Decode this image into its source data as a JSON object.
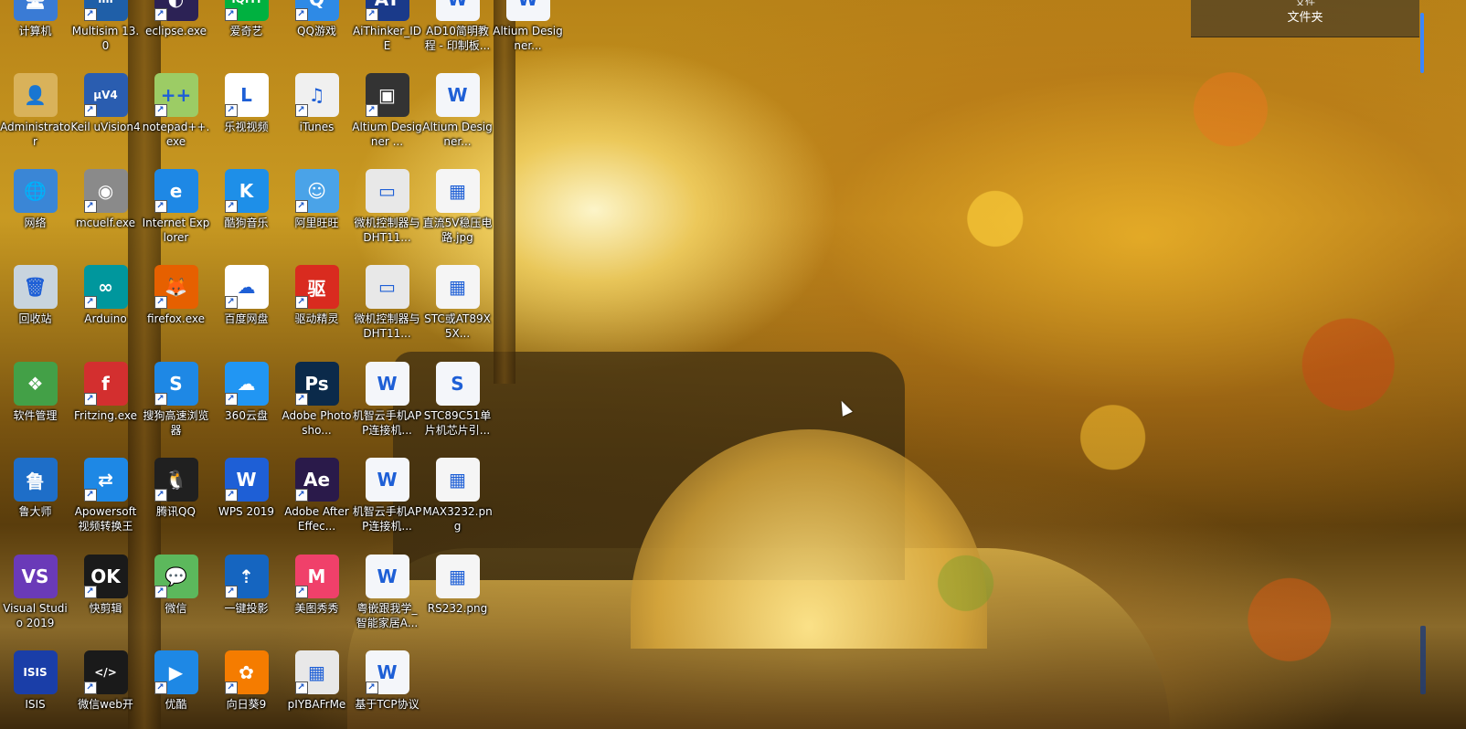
{
  "folder_toolbar": {
    "top_label": "文件",
    "main_label": "文件夹"
  },
  "icons": [
    {
      "label": "计算机",
      "icon": "computer-icon",
      "color": "#3a7bd5",
      "glyph": "🖥",
      "shortcut": false
    },
    {
      "label": "Multisim 13.0",
      "icon": "multisim-icon",
      "color": "#1f5fa8",
      "glyph": "ılıl",
      "shortcut": true
    },
    {
      "label": "eclipse.exe",
      "icon": "eclipse-icon",
      "color": "#2c2255",
      "glyph": "◐",
      "shortcut": true
    },
    {
      "label": "爱奇艺",
      "icon": "iqiyi-icon",
      "color": "#00b140",
      "glyph": "iQIYI",
      "shortcut": true
    },
    {
      "label": "QQ游戏",
      "icon": "qqgame-icon",
      "color": "#2e8ae6",
      "glyph": "Q",
      "shortcut": true
    },
    {
      "label": "AiThinker_IDE",
      "icon": "aithinker-icon",
      "color": "#1a3a8a",
      "glyph": "AT",
      "shortcut": true
    },
    {
      "label": "AD10简明教程 - 印制板...",
      "icon": "word-doc-icon",
      "color": "#f4f6fa",
      "glyph": "W",
      "shortcut": false
    },
    {
      "label": "Altium Designer...",
      "icon": "word-doc-icon",
      "color": "#f4f6fa",
      "glyph": "W",
      "shortcut": false
    },
    {
      "label": "Administrator",
      "icon": "user-folder-icon",
      "color": "#d9b25a",
      "glyph": "👤",
      "shortcut": false
    },
    {
      "label": "Keil uVision4",
      "icon": "keil-icon",
      "color": "#2a5db0",
      "glyph": "μV4",
      "shortcut": true
    },
    {
      "label": "notepad++.exe",
      "icon": "notepad-plus-icon",
      "color": "#9ccc65",
      "glyph": "++",
      "shortcut": true
    },
    {
      "label": "乐视视频",
      "icon": "letv-icon",
      "color": "#ffffff",
      "glyph": "L",
      "shortcut": true
    },
    {
      "label": "iTunes",
      "icon": "itunes-icon",
      "color": "#f0f0f0",
      "glyph": "♫",
      "shortcut": true
    },
    {
      "label": "Altium Designer ...",
      "icon": "altium-icon",
      "color": "#333333",
      "glyph": "▣",
      "shortcut": true
    },
    {
      "label": "Altium Designer...",
      "icon": "word-doc-icon",
      "color": "#f4f6fa",
      "glyph": "W",
      "shortcut": false
    },
    {
      "label": "网络",
      "icon": "network-icon",
      "color": "#3a86d6",
      "glyph": "🌐",
      "shortcut": false
    },
    {
      "label": "mcuelf.exe",
      "icon": "mcuelf-icon",
      "color": "#8a8a8a",
      "glyph": "◉",
      "shortcut": true
    },
    {
      "label": "Internet Explorer",
      "icon": "internet-explorer-icon",
      "color": "#1e88e5",
      "glyph": "e",
      "shortcut": true
    },
    {
      "label": "酷狗音乐",
      "icon": "kugou-icon",
      "color": "#1e8fe8",
      "glyph": "K",
      "shortcut": true
    },
    {
      "label": "阿里旺旺",
      "icon": "aliwangwang-icon",
      "color": "#4aa3e8",
      "glyph": "☺",
      "shortcut": true
    },
    {
      "label": "微机控制器与DHT11...",
      "icon": "image-file-icon",
      "color": "#e8e8e8",
      "glyph": "▭",
      "shortcut": false
    },
    {
      "label": "直流5V稳压电路.jpg",
      "icon": "image-file-icon",
      "color": "#f5f5f5",
      "glyph": "▦",
      "shortcut": false
    },
    {
      "label": "回收站",
      "icon": "recycle-bin-icon",
      "color": "#c8d4de",
      "glyph": "🗑",
      "shortcut": false
    },
    {
      "label": "Arduino",
      "icon": "arduino-icon",
      "color": "#00979d",
      "glyph": "∞",
      "shortcut": true
    },
    {
      "label": "firefox.exe",
      "icon": "firefox-icon",
      "color": "#e66000",
      "glyph": "🦊",
      "shortcut": true
    },
    {
      "label": "百度网盘",
      "icon": "baidu-netdisk-icon",
      "color": "#ffffff",
      "glyph": "☁",
      "shortcut": true
    },
    {
      "label": "驱动精灵",
      "icon": "driver-genius-icon",
      "color": "#d92b1f",
      "glyph": "驱",
      "shortcut": true
    },
    {
      "label": "微机控制器与DHT11...",
      "icon": "image-file-icon",
      "color": "#e8e8e8",
      "glyph": "▭",
      "shortcut": false
    },
    {
      "label": "STC或AT89X5X...",
      "icon": "image-file-icon",
      "color": "#f5f5f5",
      "glyph": "▦",
      "shortcut": false
    },
    {
      "label": "软件管理",
      "icon": "software-manager-icon",
      "color": "#43a047",
      "glyph": "❖",
      "shortcut": false
    },
    {
      "label": "Fritzing.exe",
      "icon": "fritzing-icon",
      "color": "#d32f2f",
      "glyph": "f",
      "shortcut": true
    },
    {
      "label": "搜狗高速浏览器",
      "icon": "sogou-browser-icon",
      "color": "#1e88e5",
      "glyph": "S",
      "shortcut": true
    },
    {
      "label": "360云盘",
      "icon": "360-cloud-icon",
      "color": "#2196f3",
      "glyph": "☁",
      "shortcut": true
    },
    {
      "label": "Adobe Photosho...",
      "icon": "photoshop-icon",
      "color": "#0b2a4a",
      "glyph": "Ps",
      "shortcut": true
    },
    {
      "label": "机智云手机APP连接机...",
      "icon": "word-doc-icon",
      "color": "#f4f6fa",
      "glyph": "W",
      "shortcut": false
    },
    {
      "label": "STC89C51单片机芯片引...",
      "icon": "excel-doc-icon",
      "color": "#f4f6fa",
      "glyph": "S",
      "shortcut": false
    },
    {
      "label": "鲁大师",
      "icon": "ludashi-icon",
      "color": "#1e6ec8",
      "glyph": "鲁",
      "shortcut": false
    },
    {
      "label": "Apowersoft视频转换王",
      "icon": "apowersoft-icon",
      "color": "#1e88e5",
      "glyph": "⇄",
      "shortcut": true
    },
    {
      "label": "腾讯QQ",
      "icon": "qq-icon",
      "color": "#202020",
      "glyph": "🐧",
      "shortcut": true
    },
    {
      "label": "WPS 2019",
      "icon": "wps-icon",
      "color": "#1e5fd6",
      "glyph": "W",
      "shortcut": true
    },
    {
      "label": "Adobe After Effec...",
      "icon": "after-effects-icon",
      "color": "#2a1a4a",
      "glyph": "Ae",
      "shortcut": true
    },
    {
      "label": "机智云手机APP连接机...",
      "icon": "word-doc-icon",
      "color": "#f4f6fa",
      "glyph": "W",
      "shortcut": false
    },
    {
      "label": "MAX3232.png",
      "icon": "image-file-icon",
      "color": "#f5f5f5",
      "glyph": "▦",
      "shortcut": false
    },
    {
      "label": "Visual Studio 2019",
      "icon": "visual-studio-icon",
      "color": "#6a3ab8",
      "glyph": "VS",
      "shortcut": false
    },
    {
      "label": "快剪辑",
      "icon": "kuaijianji-icon",
      "color": "#1a1a1a",
      "glyph": "OK",
      "shortcut": true
    },
    {
      "label": "微信",
      "icon": "wechat-icon",
      "color": "#5cb85c",
      "glyph": "💬",
      "shortcut": true
    },
    {
      "label": "一键投影",
      "icon": "projection-icon",
      "color": "#1565c0",
      "glyph": "⇡",
      "shortcut": true
    },
    {
      "label": "美图秀秀",
      "icon": "meitu-icon",
      "color": "#f0406a",
      "glyph": "M",
      "shortcut": true
    },
    {
      "label": "粤嵌跟我学_智能家居A...",
      "icon": "word-doc-icon",
      "color": "#f4f6fa",
      "glyph": "W",
      "shortcut": false
    },
    {
      "label": "RS232.png",
      "icon": "image-file-icon",
      "color": "#f5f5f5",
      "glyph": "▦",
      "shortcut": false
    },
    {
      "label": "ISIS",
      "icon": "isis-icon",
      "color": "#1a3ea8",
      "glyph": "ISIS",
      "shortcut": false
    },
    {
      "label": "微信web开",
      "icon": "wechat-devtools-icon",
      "color": "#1a1a1a",
      "glyph": "</>",
      "shortcut": true
    },
    {
      "label": "优酷",
      "icon": "youku-icon",
      "color": "#1e88e5",
      "glyph": "▶",
      "shortcut": true
    },
    {
      "label": "向日葵9",
      "icon": "sunflower-icon",
      "color": "#f57c00",
      "glyph": "✿",
      "shortcut": true
    },
    {
      "label": "pIYBAFrMe",
      "icon": "image-file-icon",
      "color": "#e8e8e8",
      "glyph": "▦",
      "shortcut": true
    },
    {
      "label": "基于TCP协议",
      "icon": "word-doc-icon",
      "color": "#f4f6fa",
      "glyph": "W",
      "shortcut": true
    }
  ]
}
